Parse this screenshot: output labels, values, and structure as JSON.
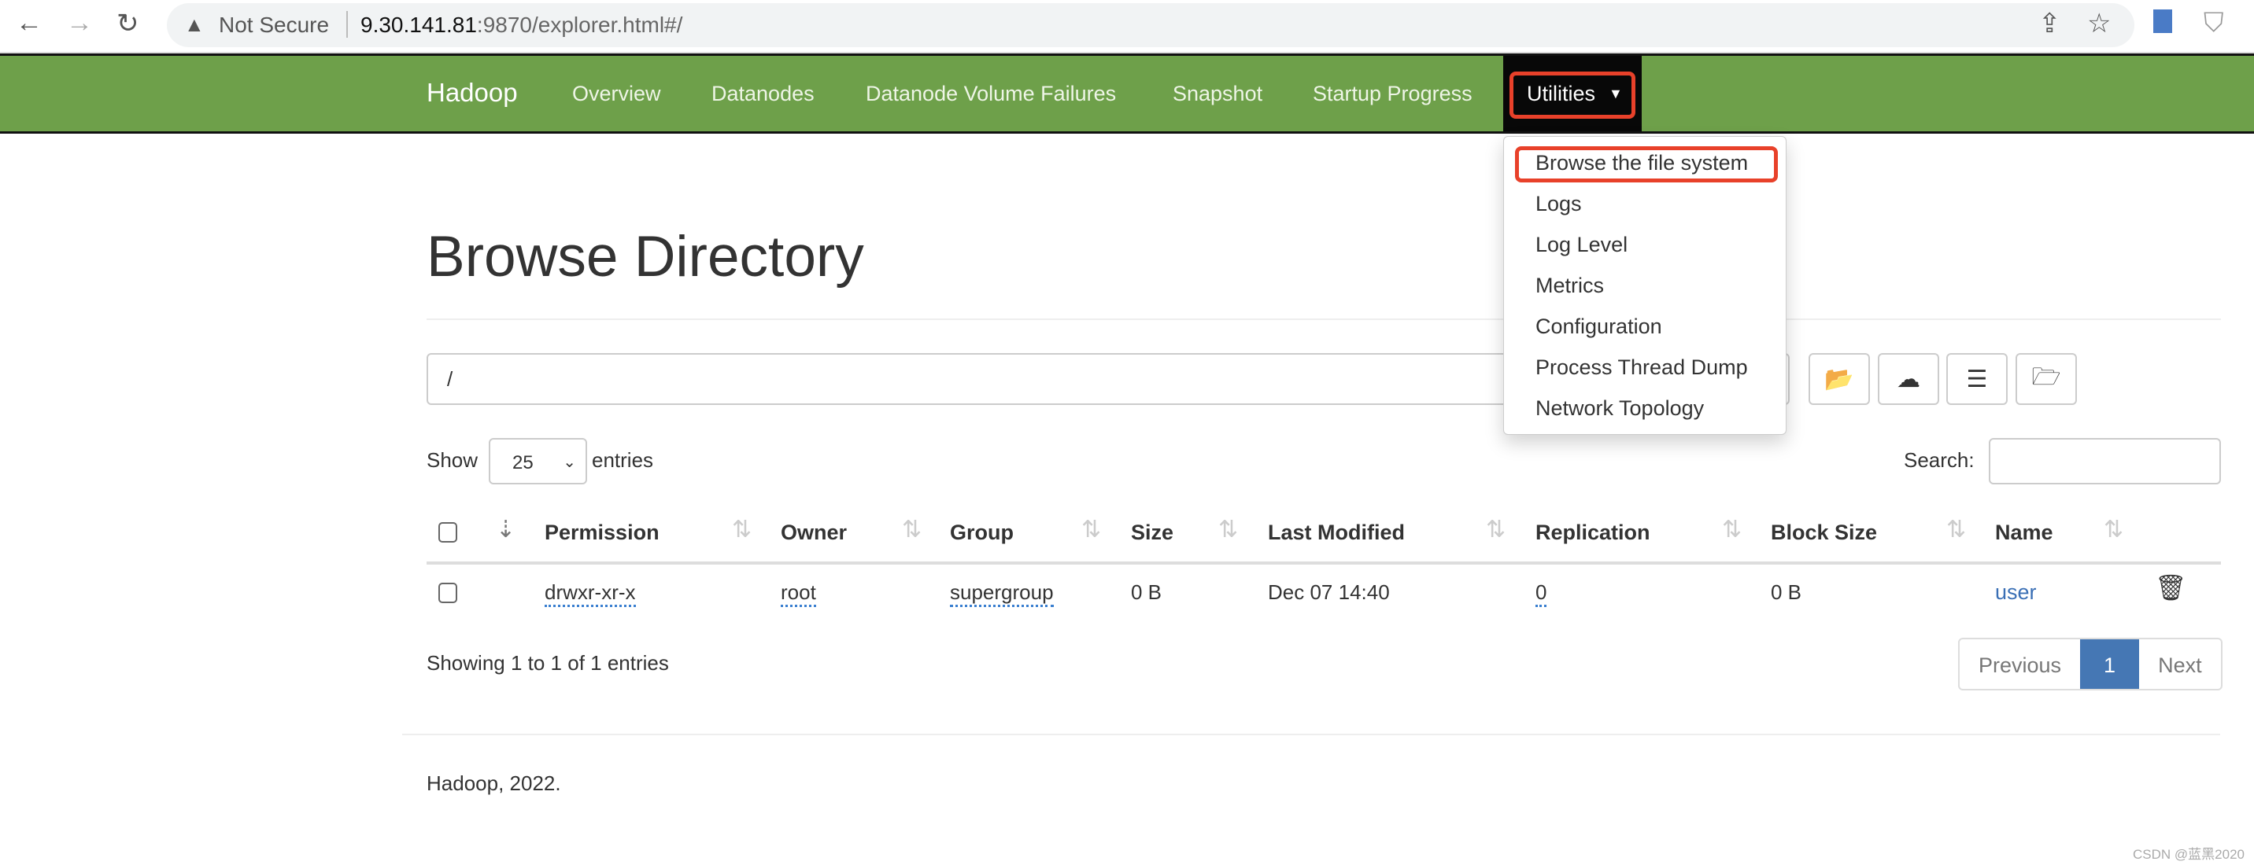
{
  "browser": {
    "security": "Not Secure",
    "url_host": "9.30.141.81",
    "url_rest": ":9870/explorer.html#/"
  },
  "nav": {
    "brand": "Hadoop",
    "items": [
      "Overview",
      "Datanodes",
      "Datanode Volume Failures",
      "Snapshot",
      "Startup Progress"
    ],
    "utilities": "Utilities"
  },
  "dropdown": [
    "Browse the file system",
    "Logs",
    "Log Level",
    "Metrics",
    "Configuration",
    "Process Thread Dump",
    "Network Topology"
  ],
  "page": {
    "title": "Browse Directory",
    "path": "/",
    "show": "Show",
    "entries": "entries",
    "page_size": "25",
    "search_label": "Search:"
  },
  "table": {
    "headers": [
      "Permission",
      "Owner",
      "Group",
      "Size",
      "Last Modified",
      "Replication",
      "Block Size",
      "Name"
    ],
    "rows": [
      {
        "permission": "drwxr-xr-x",
        "owner": "root",
        "group": "supergroup",
        "size": "0 B",
        "modified": "Dec 07 14:40",
        "replication": "0",
        "block_size": "0 B",
        "name": "user"
      }
    ]
  },
  "info": "Showing 1 to 1 of 1 entries",
  "pager": {
    "prev": "Previous",
    "current": "1",
    "next": "Next"
  },
  "footer": "Hadoop, 2022.",
  "watermark": "CSDN @蓝黑2020",
  "colors": {
    "nav": "#6ea04a",
    "highlight": "#e8412a",
    "link": "#3a6fb5",
    "active_page": "#4577b4"
  }
}
